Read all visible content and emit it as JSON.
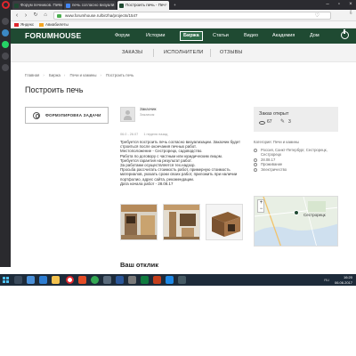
{
  "browser": {
    "tabs": [
      {
        "label": "Форум печников. Печи",
        "active": false,
        "favicon_color": "#1f4a32"
      },
      {
        "label": "печь согласно визуали",
        "active": false,
        "favicon_color": "#4285f4"
      },
      {
        "label": "Построить печь - Печ",
        "active": true,
        "favicon_color": "#1f4a32"
      }
    ],
    "url": "www.forumhouse.ru/birzha/projects/1547",
    "bookmarks": [
      "Яндекс",
      "Авиабилеты"
    ]
  },
  "site": {
    "logo": "FORUMHOUSE",
    "nav": [
      "Форум",
      "Истории",
      "Биржа",
      "Статьи",
      "Видео",
      "Академия",
      "Дом"
    ],
    "active_nav": "Биржа",
    "subnav": [
      "ЗАКАЗЫ",
      "ИСПОЛНИТЕЛИ",
      "ОТЗЫВЫ"
    ]
  },
  "breadcrumbs": [
    "Главная",
    "Биржа",
    "Печи и камины",
    "Построить печь"
  ],
  "page": {
    "title": "Построить печь",
    "formulate_button": "ФОРМУЛИРОВКА ЗАДАЧИ",
    "author_name": "Заказчик",
    "author_role": "Заказчик",
    "meta": [
      "06.0 - 26.07",
      "1 неделя назад"
    ],
    "description": [
      "Требуется построить печь согласно визуализации. Заказчик будет",
      "строиться после окончания печных работ.",
      "Местоположение - Сестрорецк, садоводство.",
      "Работа по договору с частным или юридическим лицом.",
      "Требуется гарантия на результат работ.",
      "За работами осуществляется тех.надзор.",
      "Просьба рассчитать стоимость работ, примерную стоимость",
      "материалов, указать сроки своих работ, приложить при наличии",
      "портфолио, адрес сайта, рекомендации.",
      "Дата начала работ - 28.08.17"
    ],
    "response_heading": "Ваш отклик"
  },
  "right_panel": {
    "status": "Заказ открыт",
    "views": "67",
    "bids": "3",
    "category": "Категория: Печи и камины",
    "location": "Россия, Санкт-Петербург, Сестрорецк, Сестрорецк",
    "date": "28.08.17",
    "housing": "Проживание",
    "power": "Электричество",
    "map_label": "Сестрорецк",
    "map_zoom_in": "+",
    "map_zoom_out": "−"
  },
  "taskbar": {
    "time": "16:20",
    "date": "06.06.2017",
    "tray": "RU"
  },
  "colors": {
    "brand_green": "#1f4a32",
    "taskbar": "#1d2b3a",
    "opera_red": "#e0262d"
  }
}
